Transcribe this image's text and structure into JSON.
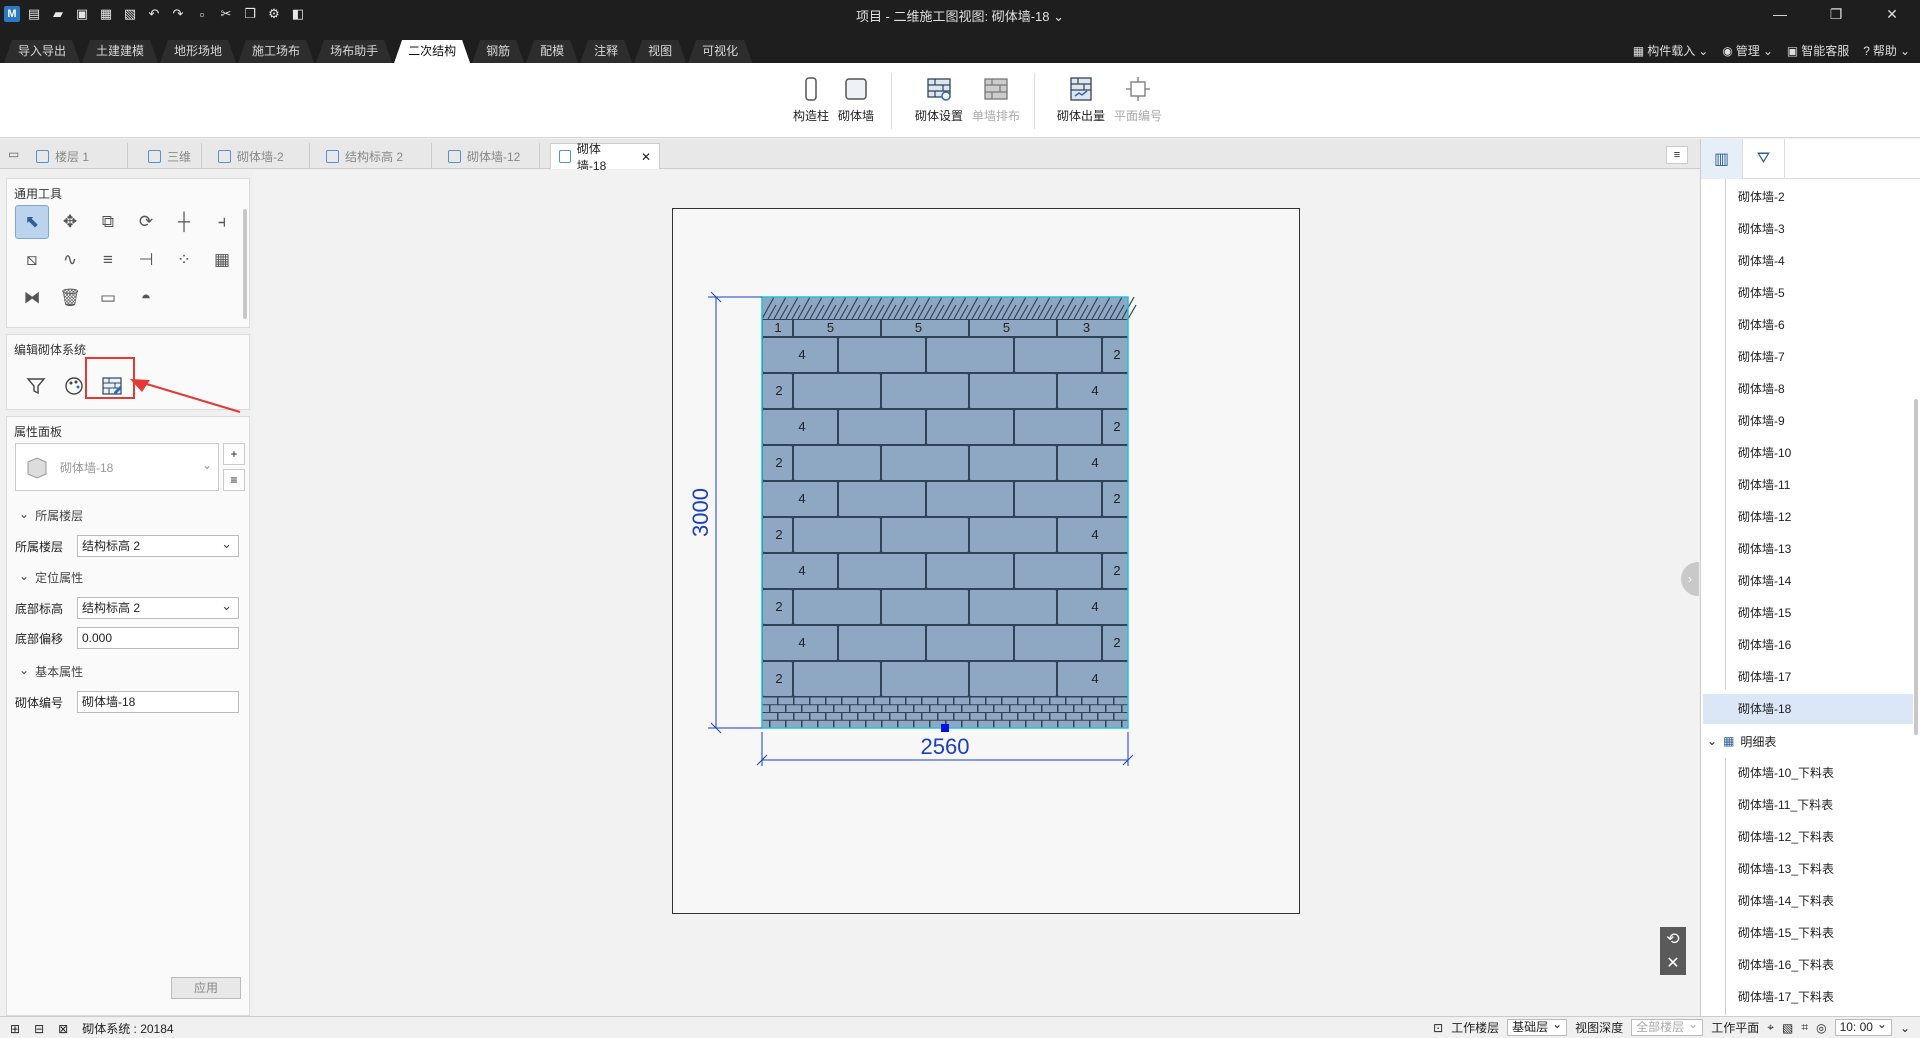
{
  "window": {
    "title": "项目 - 二维施工图视图: 砌体墙-18",
    "minimize": "—",
    "maximize": "❐",
    "close": "✕"
  },
  "ribbon_tabs": [
    "导入导出",
    "土建建模",
    "地形场地",
    "施工场布",
    "场布助手",
    "二次结构",
    "钢筋",
    "配模",
    "注释",
    "视图",
    "可视化"
  ],
  "active_ribbon_tab": "二次结构",
  "ribbon_right": {
    "component_load": "构件载入",
    "manage": "管理",
    "smart_service": "智能客服",
    "help": "帮助"
  },
  "ribbon_buttons": {
    "constructional_column": "构造柱",
    "masonry_wall": "砌体墙",
    "masonry_settings": "砌体设置",
    "single_wall_layout": "单墙排布",
    "masonry_output": "砌体出量",
    "plan_numbering": "平面编号"
  },
  "doc_tabs": [
    "楼层 1",
    "三维",
    "砌体墙-2",
    "结构标高 2",
    "砌体墙-12",
    "砌体墙-18"
  ],
  "active_doc_tab": "砌体墙-18",
  "left_panel": {
    "general_tools_title": "通用工具",
    "edit_masonry_title": "编辑砌体系统",
    "properties_title": "属性面板",
    "type_selector": "砌体墙-18",
    "group_floor": "所属楼层",
    "floor_label": "所属楼层",
    "floor_value": "结构标高 2",
    "group_position": "定位属性",
    "bottom_elev_label": "底部标高",
    "bottom_elev_value": "结构标高 2",
    "bottom_offset_label": "底部偏移",
    "bottom_offset_value": "0.000",
    "group_basic": "基本属性",
    "wall_id_label": "砌体编号",
    "wall_id_value": "砌体墙-18",
    "apply_button": "应用"
  },
  "drawing": {
    "height_dim": "3000",
    "width_dim": "2560",
    "top_row_labels": [
      "1",
      "5",
      "5",
      "5",
      "3"
    ],
    "row_labels_a": [
      "4",
      "2"
    ],
    "row_labels_b": [
      "2",
      "4"
    ],
    "colors": {
      "brick": "#8ea8c3",
      "mortar": "#2f4458",
      "dimension": "#1a3fc4",
      "outline": "#1fc3d8"
    }
  },
  "right_panel": {
    "walls": [
      "砌体墙-2",
      "砌体墙-3",
      "砌体墙-4",
      "砌体墙-5",
      "砌体墙-6",
      "砌体墙-7",
      "砌体墙-8",
      "砌体墙-9",
      "砌体墙-10",
      "砌体墙-11",
      "砌体墙-12",
      "砌体墙-13",
      "砌体墙-14",
      "砌体墙-15",
      "砌体墙-16",
      "砌体墙-17",
      "砌体墙-18"
    ],
    "selected_wall": "砌体墙-18",
    "schedule_group": "明细表",
    "schedules": [
      "砌体墙-10_下料表",
      "砌体墙-11_下料表",
      "砌体墙-12_下料表",
      "砌体墙-13_下料表",
      "砌体墙-14_下料表",
      "砌体墙-15_下料表",
      "砌体墙-16_下料表",
      "砌体墙-17_下料表"
    ]
  },
  "status": {
    "masonry_system": "砌体系统 : 20184",
    "work_floor_label": "工作楼层",
    "work_floor_value": "基础层",
    "view_depth_label": "视图深度",
    "view_depth_value": "全部楼层",
    "work_plane_label": "工作平面",
    "time_value": "10: 00"
  }
}
